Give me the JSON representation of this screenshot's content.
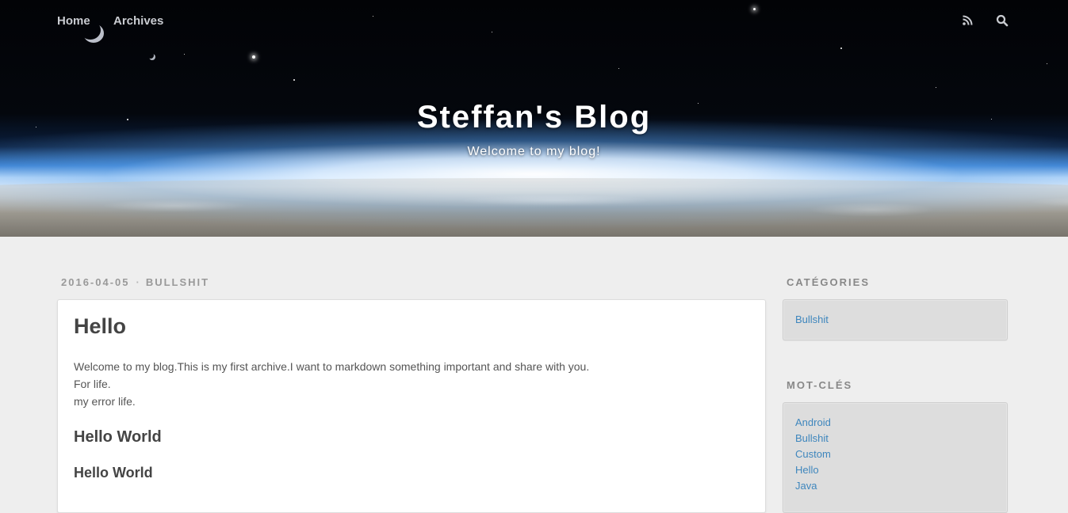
{
  "nav": {
    "home": "Home",
    "archives": "Archives",
    "rss_icon": "rss-icon",
    "search_icon": "search-icon"
  },
  "banner": {
    "title": "Steffan's Blog",
    "subtitle": "Welcome to my blog!"
  },
  "article": {
    "date": "2016-04-05",
    "separator": "·",
    "category": "BULLSHIT",
    "title": "Hello",
    "paragraph_lines": [
      "Welcome to my blog.This is my first archive.I want to markdown something important and share with you.",
      "For life.",
      "my error life."
    ],
    "heading_2": "Hello World",
    "heading_3": "Hello World"
  },
  "sidebar": {
    "categories_title": "CATÉGORIES",
    "categories": [
      "Bullshit"
    ],
    "tags_title": "MOT-CLÉS",
    "tags": [
      "Android",
      "Bullshit",
      "Custom",
      "Hello",
      "Java"
    ]
  },
  "colors": {
    "link": "#3e86bd",
    "background": "#eeeeee",
    "meta_text": "#999999"
  }
}
